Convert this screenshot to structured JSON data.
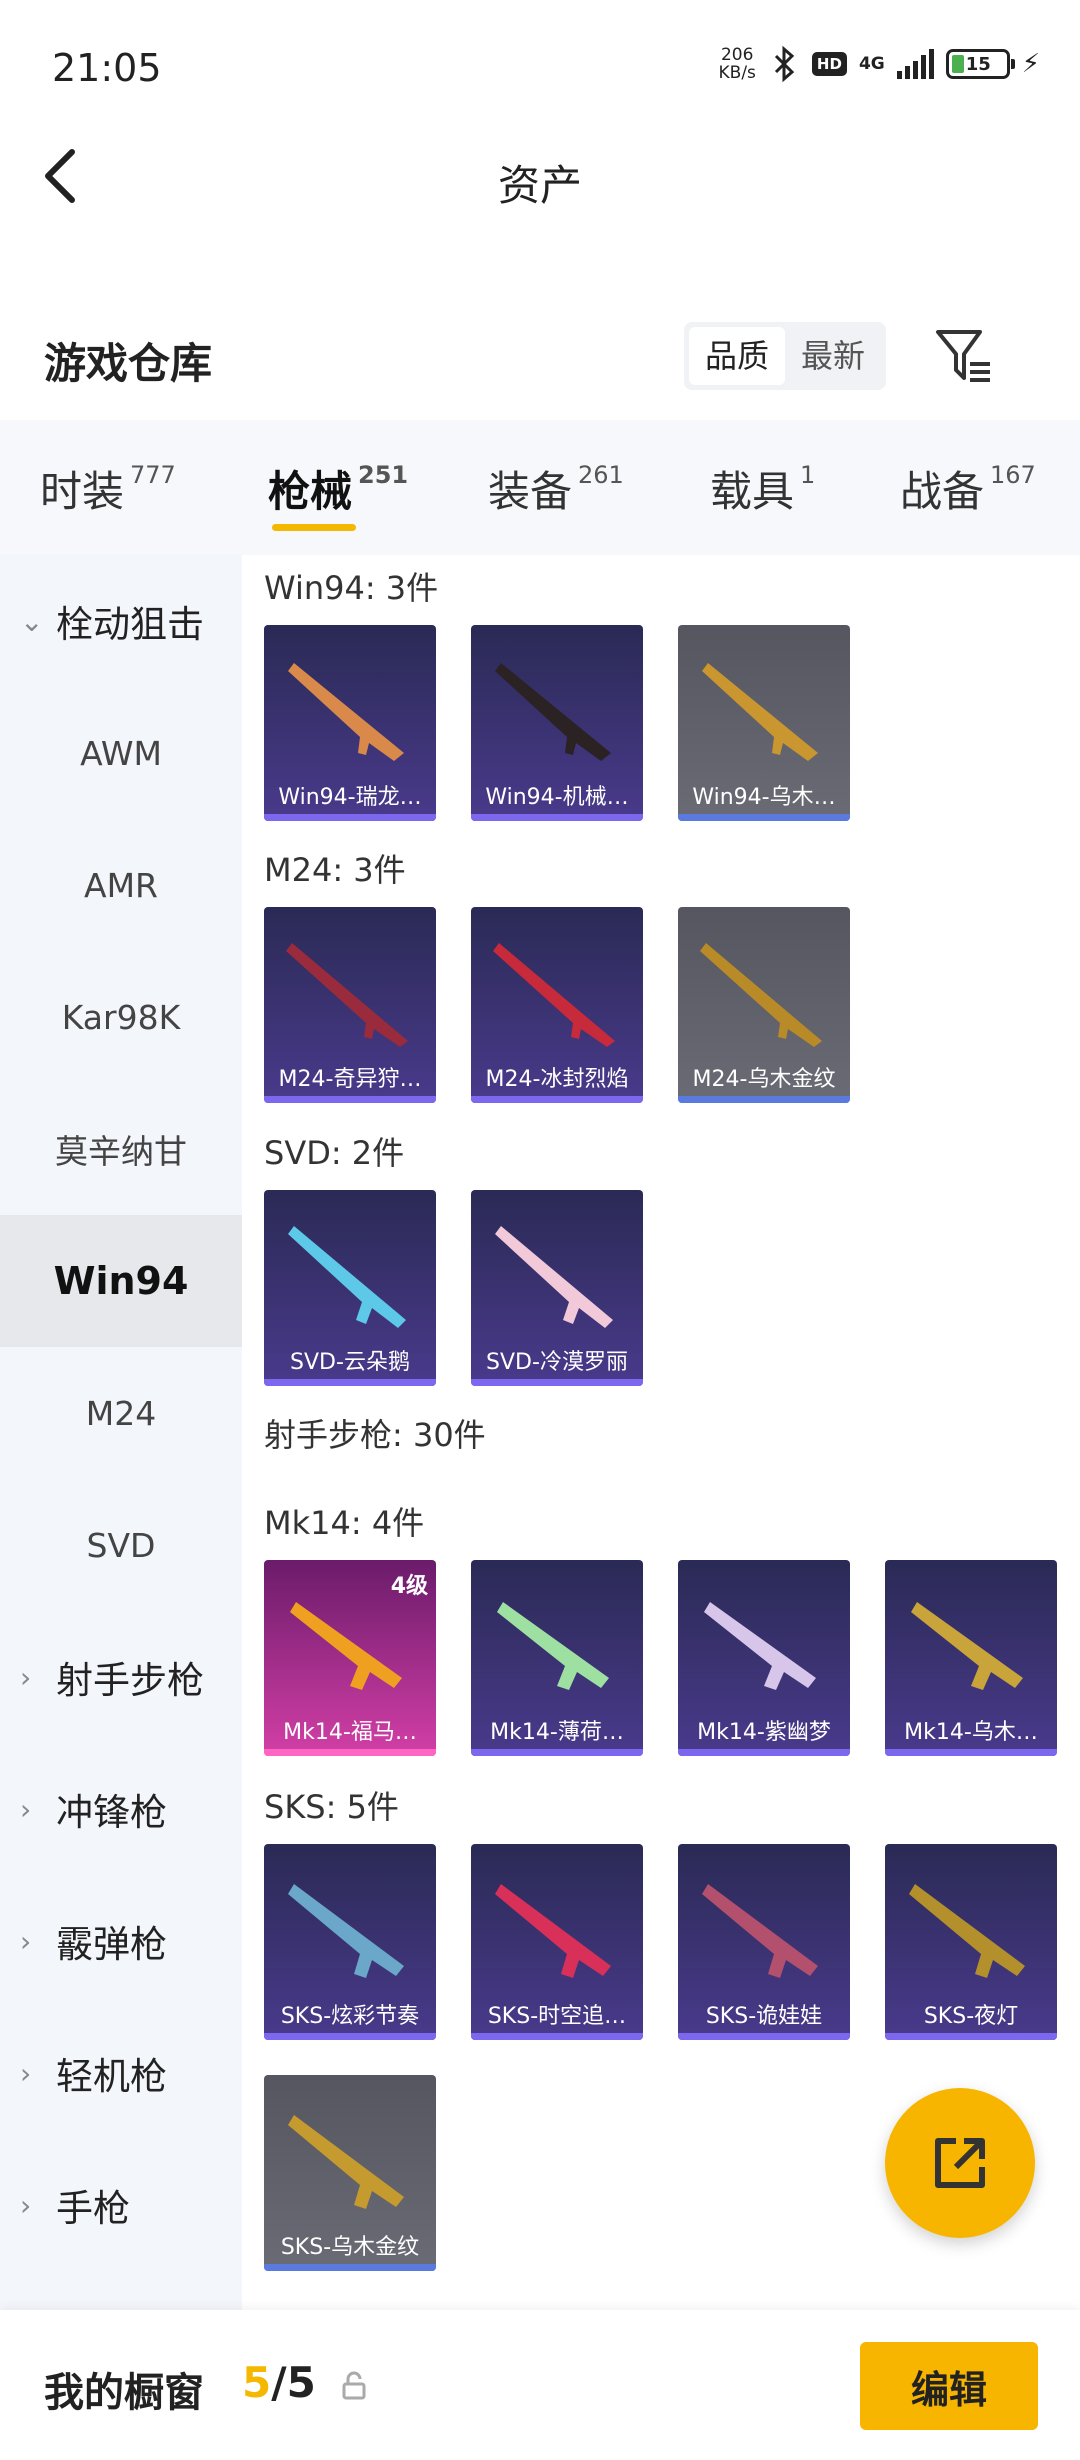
{
  "status": {
    "time": "21:05",
    "speed_value": "206",
    "speed_unit": "KB/s",
    "hd": "HD",
    "network": "4G",
    "battery": "15"
  },
  "header": {
    "title": "资产"
  },
  "warehouse": {
    "title": "游戏仓库",
    "sort_quality": "品质",
    "sort_latest": "最新"
  },
  "tabs": [
    {
      "label": "时装",
      "count": "777"
    },
    {
      "label": "枪械",
      "count": "251"
    },
    {
      "label": "装备",
      "count": "261"
    },
    {
      "label": "载具",
      "count": "1"
    },
    {
      "label": "战备",
      "count": "167"
    }
  ],
  "sidebar": [
    {
      "label": "栓动狙击"
    },
    {
      "label": "AWM"
    },
    {
      "label": "AMR"
    },
    {
      "label": "Kar98K"
    },
    {
      "label": "莫辛纳甘"
    },
    {
      "label": "Win94"
    },
    {
      "label": "M24"
    },
    {
      "label": "SVD"
    },
    {
      "label": "射手步枪"
    },
    {
      "label": "冲锋枪"
    },
    {
      "label": "霰弹枪"
    },
    {
      "label": "轻机枪"
    },
    {
      "label": "手枪"
    }
  ],
  "groups": [
    {
      "label": "Win94: 3件",
      "items": [
        "Win94-瑞龙…",
        "Win94-机械…",
        "Win94-乌木…"
      ]
    },
    {
      "label": "M24: 3件",
      "items": [
        "M24-奇异狩…",
        "M24-冰封烈焰",
        "M24-乌木金纹"
      ]
    },
    {
      "label": "SVD: 2件",
      "items": [
        "SVD-云朵鹅",
        "SVD-冷漠罗丽"
      ]
    },
    {
      "label": "射手步枪: 30件"
    },
    {
      "label": "Mk14: 4件",
      "items": [
        "Mk14-福马…",
        "Mk14-薄荷…",
        "Mk14-紫幽梦",
        "Mk14-乌木…"
      ],
      "level": "4级"
    },
    {
      "label": "SKS: 5件",
      "items": [
        "SKS-炫彩节奏",
        "SKS-时空追…",
        "SKS-诡娃娃",
        "SKS-夜灯",
        "SKS-乌木金纹"
      ]
    }
  ],
  "bottom": {
    "showcase_label": "我的橱窗",
    "showcase_current": "5",
    "showcase_total": "/5",
    "edit_label": "编辑"
  },
  "colors": {
    "accent": "#f7b500",
    "card_purple": "#4a3a8c",
    "card_grey": "#6a6b75",
    "card_pink": "#d33fa6"
  }
}
